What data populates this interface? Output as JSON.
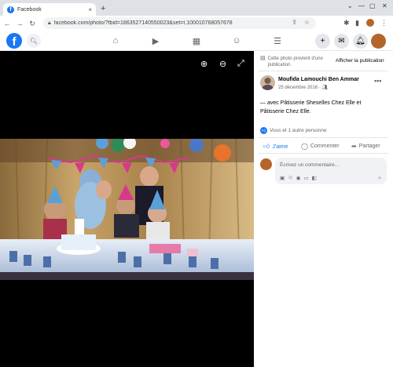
{
  "browser": {
    "tab_title": "Facebook",
    "tab_close": "×",
    "new_tab": "+",
    "url": "facebook.com/photo/?fbid=1863527140550023&set=t.100010768057678",
    "back": "←",
    "forward": "→",
    "reload": "↻",
    "minimize": "—",
    "maximize": "▢",
    "close": "✕",
    "window_menu": "⌄"
  },
  "facebook_bar": {
    "logo": "f",
    "icons": [
      "home-icon",
      "video-icon",
      "marketplace-icon",
      "groups-icon",
      "menu-icon"
    ]
  },
  "viewer": {
    "zoom_in": "⊕",
    "zoom_out": "⊖",
    "fullscreen": "⤢"
  },
  "post": {
    "notice": "Cette photo provient d'une publication.",
    "show_publication": "Afficher la publication",
    "author": "Moufida Lamouchi Ben Ammar",
    "date": "25 décembre 2016",
    "more": "•••",
    "caption": "— avec Pâtisserie Sheselles Chez Elle et Pâtisserie Chez Elle.",
    "reactions": "Vous et 1 autre personne",
    "like_label": "J'aime",
    "comment_label": "Commenter",
    "share_label": "Partager",
    "comment_placeholder": "Écrivez un commentaire…"
  },
  "colors": {
    "facebook_blue": "#1877f2",
    "viewer_bg": "#000000"
  }
}
